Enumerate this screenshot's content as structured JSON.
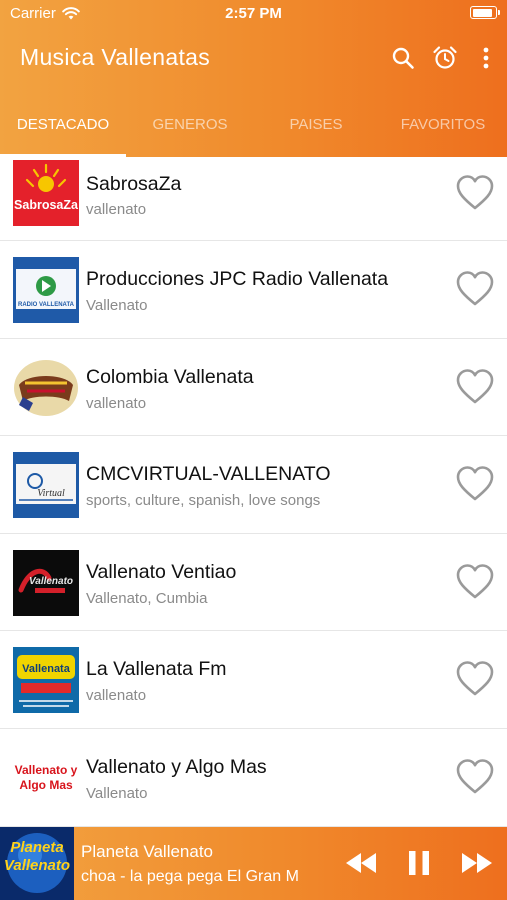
{
  "status_bar": {
    "carrier": "Carrier",
    "time": "2:57 PM",
    "battery_level": 0.92
  },
  "app": {
    "title": "Musica Vallenatas"
  },
  "toolbar": {
    "icons": [
      "search-icon",
      "alarm-clock-icon",
      "more-vertical-icon"
    ]
  },
  "tabs": [
    {
      "label": "DESTACADO",
      "active": true
    },
    {
      "label": "GENEROS",
      "active": false
    },
    {
      "label": "PAISES",
      "active": false
    },
    {
      "label": "FAVORITOS",
      "active": false
    }
  ],
  "stations": [
    {
      "name": "SabrosaZa",
      "tags": "vallenato",
      "logo": {
        "caption": "SabrosaZa"
      }
    },
    {
      "name": "Producciones JPC Radio Vallenata",
      "tags": "Vallenato",
      "logo": {
        "caption": "RADIO VALLENATA"
      }
    },
    {
      "name": "Colombia Vallenata",
      "tags": "vallenato",
      "logo": {
        "caption": ""
      }
    },
    {
      "name": "CMCVIRTUAL-VALLENATO",
      "tags": "sports, culture, spanish, love songs",
      "logo": {
        "caption": "Virtual"
      }
    },
    {
      "name": "Vallenato Ventiao",
      "tags": "Vallenato, Cumbia",
      "logo": {
        "caption": "Vallenato"
      }
    },
    {
      "name": "La Vallenata Fm",
      "tags": "vallenato",
      "logo": {
        "caption": "Vallenata"
      }
    },
    {
      "name": "Vallenato y Algo Mas",
      "tags": "Vallenato",
      "logo": {
        "caption": "Vallenato y Algo Mas"
      }
    }
  ],
  "player": {
    "station": "Planeta Vallenato",
    "now_playing": "choa - la pega pega    El Gran M",
    "art_caption": "Planeta Vallenato",
    "controls": [
      "rewind-icon",
      "pause-icon",
      "fast-forward-icon"
    ]
  },
  "colors": {
    "accent_start": "#f2a341",
    "accent_end": "#ee6f1e",
    "heart": "#9a9a9a"
  }
}
